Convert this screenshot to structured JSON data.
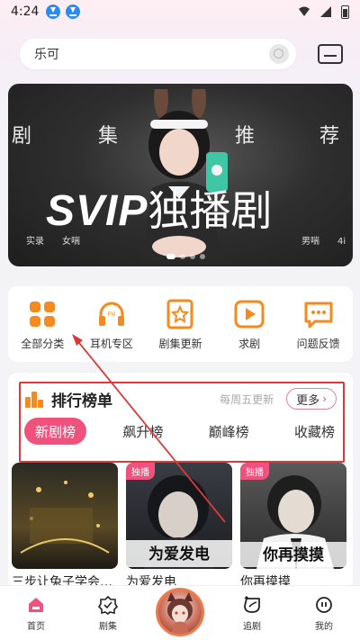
{
  "status_bar": {
    "time": "4:24"
  },
  "search": {
    "value": "乐可"
  },
  "banner": {
    "labels": [
      "剧",
      "集",
      "推",
      "荐"
    ],
    "title_latin": "SVIP",
    "title_cn": "独播剧",
    "tag_left_1": "实录",
    "tag_left_2": "女喘",
    "tag_right_1": "男喘",
    "tag_right_2": "4i"
  },
  "shortcuts": [
    {
      "label": "全部分类",
      "icon": "grid-icon"
    },
    {
      "label": "耳机专区",
      "icon": "headphones-icon"
    },
    {
      "label": "剧集更新",
      "icon": "star-bookmark-icon"
    },
    {
      "label": "求剧",
      "icon": "play-icon"
    },
    {
      "label": "问题反馈",
      "icon": "message-icon"
    }
  ],
  "ranking": {
    "title": "排行榜单",
    "update_note": "每周五更新",
    "more_label": "更多",
    "tabs": [
      "新剧榜",
      "飙升榜",
      "巅峰榜",
      "收藏榜"
    ],
    "active_tab": 0
  },
  "cards": [
    {
      "title": "三步让兔子学会…",
      "badge": ""
    },
    {
      "title": "为爱发电",
      "badge": "独播",
      "cover_text": "为爱发电"
    },
    {
      "title": "你再摸摸",
      "badge": "独播",
      "cover_text": "你再摸摸"
    }
  ],
  "tabbar": {
    "items": [
      "首页",
      "剧集",
      "",
      "追剧",
      "我的"
    ]
  },
  "colors": {
    "accent": "#f0527d",
    "orange": "#f58a1f",
    "annotation": "#d93a3a"
  }
}
